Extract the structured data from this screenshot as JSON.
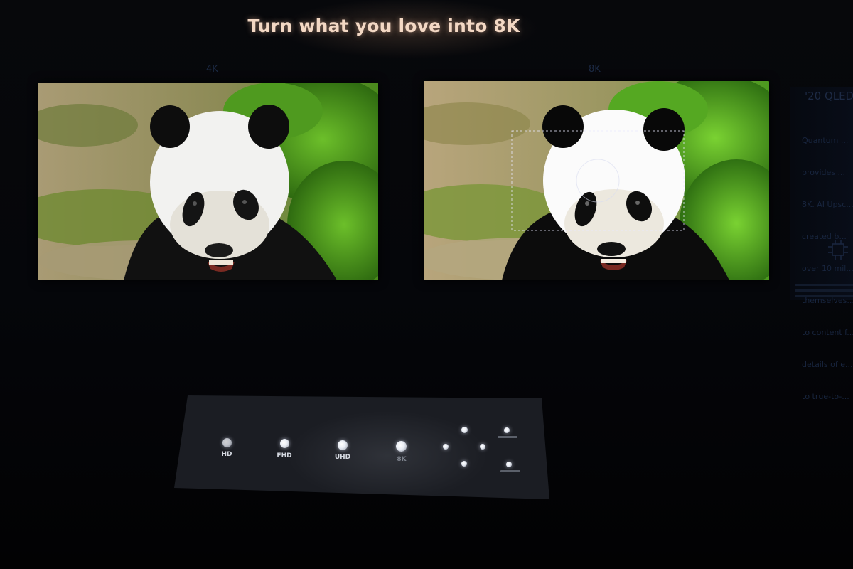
{
  "headline": "Turn what you love into 8K",
  "screens": [
    {
      "label": "4K",
      "style": "softer"
    },
    {
      "label": "8K",
      "style": "upscaled"
    }
  ],
  "side_panel": {
    "title": "'20 QLED",
    "text_lines": [
      "Quantum ...",
      "provides ...",
      "8K. AI Upsc...",
      "created b...",
      "over 10 mil...",
      "themselves...",
      "to content f...",
      "details of e...",
      "to true-to-..."
    ]
  },
  "controls": {
    "resolution_buttons": [
      {
        "label": "HD",
        "active": false
      },
      {
        "label": "FHD",
        "active": true
      },
      {
        "label": "UHD",
        "active": true
      },
      {
        "label": "8K",
        "active": false
      }
    ]
  },
  "colors": {
    "headline_glow": "#f3d8c4",
    "foliage": "#4f9a1f",
    "ground": "#b3a47a",
    "panel": "#1b1d23"
  }
}
